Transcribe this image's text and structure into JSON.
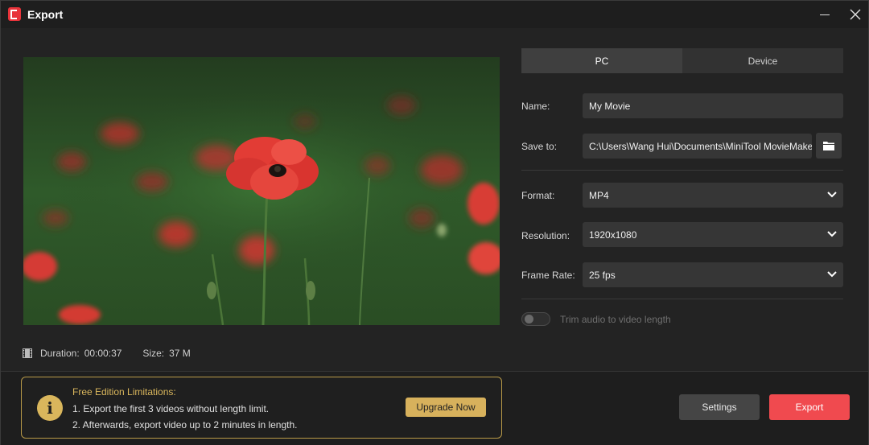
{
  "window": {
    "title": "Export"
  },
  "preview": {
    "duration_label": "Duration:",
    "duration_value": "00:00:37",
    "size_label": "Size:",
    "size_value": "37 M"
  },
  "tabs": [
    {
      "label": "PC",
      "active": true
    },
    {
      "label": "Device",
      "active": false
    }
  ],
  "form": {
    "name_label": "Name:",
    "name_value": "My Movie",
    "save_label": "Save to:",
    "save_value": "C:\\Users\\Wang Hui\\Documents\\MiniTool MovieMaker\\",
    "format_label": "Format:",
    "format_value": "MP4",
    "resolution_label": "Resolution:",
    "resolution_value": "1920x1080",
    "framerate_label": "Frame Rate:",
    "framerate_value": "25 fps",
    "trim_label": "Trim audio to video length",
    "trim_enabled": false
  },
  "limits": {
    "title": "Free Edition Limitations:",
    "line1": "1. Export the first 3 videos without length limit.",
    "line2": "2. Afterwards, export video up to 2 minutes in length.",
    "upgrade_label": "Upgrade Now"
  },
  "actions": {
    "settings_label": "Settings",
    "export_label": "Export"
  },
  "colors": {
    "accent": "#f04a4f",
    "warning": "#d9b65c",
    "background": "#232323"
  }
}
